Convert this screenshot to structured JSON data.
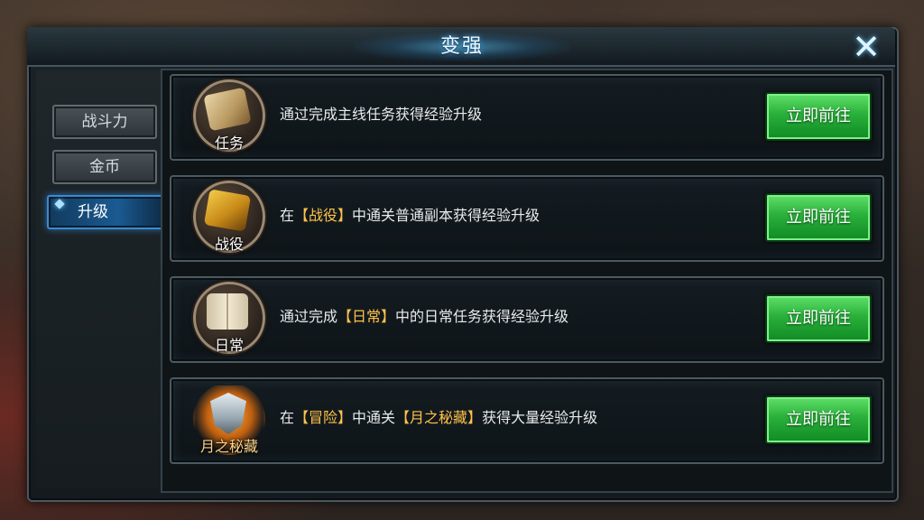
{
  "window": {
    "title": "变强",
    "close_label": "✕"
  },
  "sidebar": {
    "tabs": [
      {
        "label": "战斗力",
        "active": false
      },
      {
        "label": "金币",
        "active": false
      },
      {
        "label": "升级",
        "active": true
      }
    ]
  },
  "entries": [
    {
      "icon": "quest-scroll-icon",
      "icon_label": "任务",
      "desc_parts": [
        "通过完成主线任务获得经验升级"
      ],
      "button": "立即前往"
    },
    {
      "icon": "campaign-map-icon",
      "icon_label": "战役",
      "desc_parts": [
        "在",
        "【战役】",
        "中通关普通副本获得经验升级"
      ],
      "button": "立即前往"
    },
    {
      "icon": "daily-book-icon",
      "icon_label": "日常",
      "desc_parts": [
        "通过完成",
        "【日常】",
        "中的日常任务获得经验升级"
      ],
      "button": "立即前往"
    },
    {
      "icon": "adventure-shield-icon",
      "icon_label": "月之秘藏",
      "desc_parts": [
        "在",
        "【冒险】",
        "中通关",
        "【月之秘藏】",
        "获得大量经验升级"
      ],
      "button": "立即前往"
    }
  ],
  "colors": {
    "highlight": "#ffc24a",
    "button_green": "#29b03a",
    "tab_active": "#1a5a92"
  }
}
